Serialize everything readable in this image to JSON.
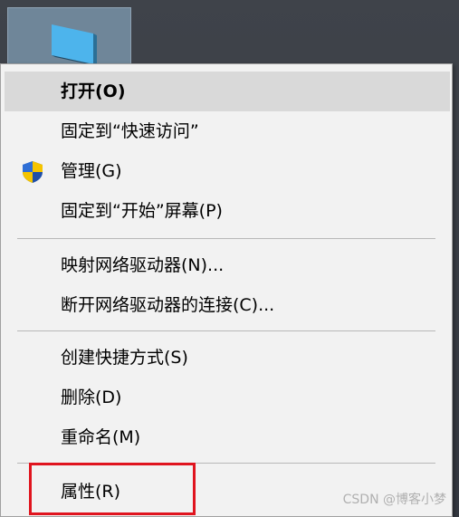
{
  "desktop": {
    "icon_name": "monitor-icon"
  },
  "menu": {
    "items": [
      {
        "label": "打开(O)"
      },
      {
        "label": "固定到“快速访问”"
      },
      {
        "label": "管理(G)",
        "icon": "uac-shield-icon"
      },
      {
        "label": "固定到“开始”屏幕(P)"
      },
      {
        "label": "映射网络驱动器(N)..."
      },
      {
        "label": "断开网络驱动器的连接(C)..."
      },
      {
        "label": "创建快捷方式(S)"
      },
      {
        "label": "删除(D)"
      },
      {
        "label": "重命名(M)"
      },
      {
        "label": "属性(R)"
      }
    ]
  },
  "highlight_color": "#e0141e",
  "watermark": "CSDN @博客小梦"
}
